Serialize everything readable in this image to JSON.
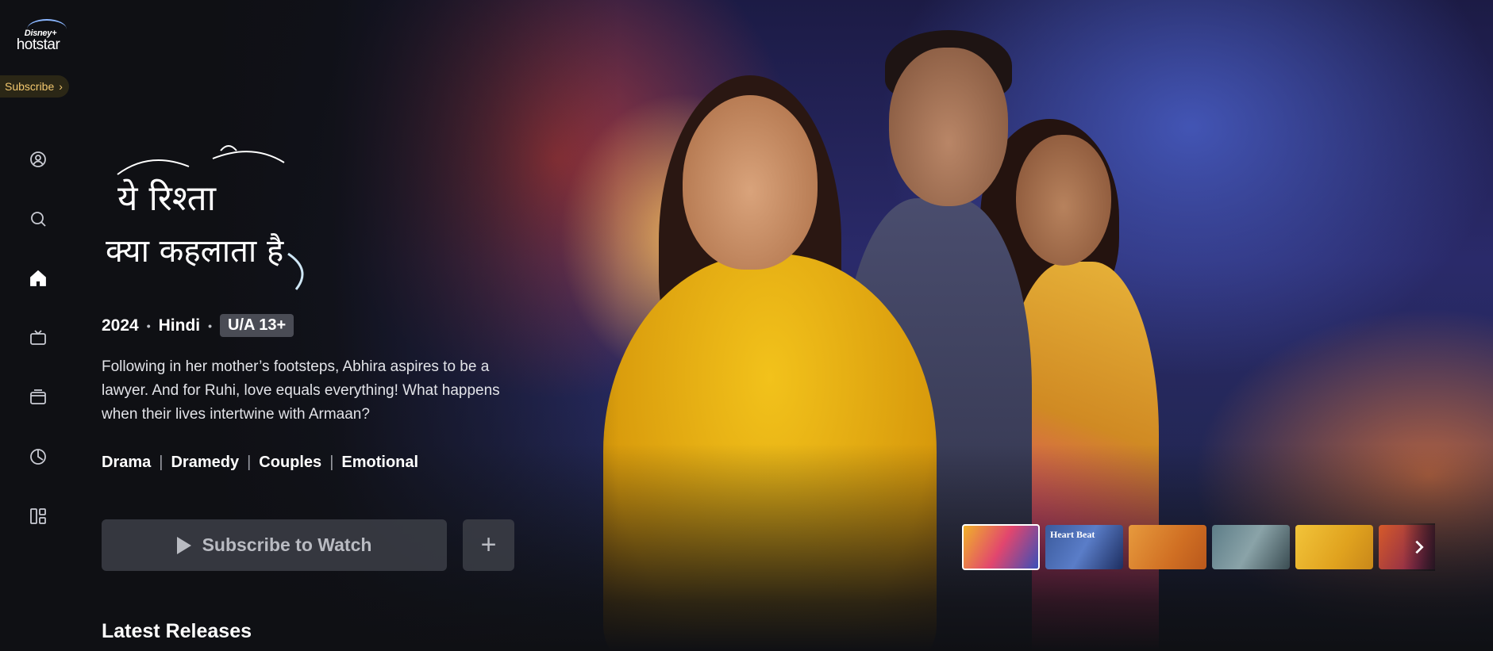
{
  "brand": {
    "logo_top": "Disney+",
    "logo_main": "hotstar",
    "subscribe_label": "Subscribe"
  },
  "sidebar": {
    "items": [
      {
        "name": "profile",
        "icon": "user-circle-icon"
      },
      {
        "name": "search",
        "icon": "search-icon"
      },
      {
        "name": "home",
        "icon": "home-icon",
        "active": true
      },
      {
        "name": "tv",
        "icon": "tv-icon"
      },
      {
        "name": "movies",
        "icon": "movies-icon"
      },
      {
        "name": "sports",
        "icon": "sports-icon"
      },
      {
        "name": "categories",
        "icon": "categories-icon"
      }
    ]
  },
  "hero": {
    "title_logo_text": [
      "ये रिश्ता",
      "क्या कहलाता है"
    ],
    "year": "2024",
    "language": "Hindi",
    "rating": "U/A 13+",
    "description": "Following in her mother’s footsteps, Abhira aspires to be a lawyer. And for Ruhi, love equals everything! What happens when their lives intertwine with Armaan?",
    "genres": [
      "Drama",
      "Dramedy",
      "Couples",
      "Emotional"
    ],
    "watch_label": "Subscribe to Watch",
    "add_label": "+"
  },
  "thumbnails": [
    {
      "label": "",
      "active": true
    },
    {
      "label": "Heart Beat"
    },
    {
      "label": ""
    },
    {
      "label": ""
    },
    {
      "label": ""
    },
    {
      "label": ""
    }
  ],
  "sections": {
    "latest_releases": "Latest Releases"
  }
}
